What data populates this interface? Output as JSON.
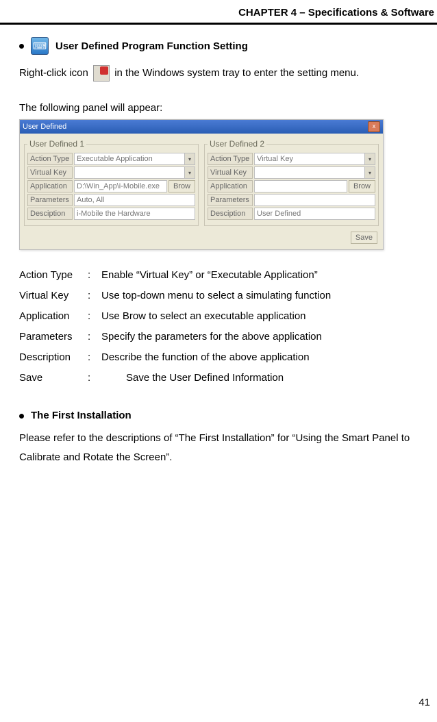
{
  "header": {
    "chapter": "CHAPTER 4 – Specifications & Software"
  },
  "s1": {
    "title": "User Defined Program Function Setting",
    "p1a": "Right-click icon ",
    "p1b": " in the Windows system tray to enter the setting menu.",
    "caption": "The following panel will appear:"
  },
  "panel": {
    "title": "User Defined",
    "close_x": "x",
    "g1": {
      "legend": "User Defined 1",
      "action_type_lbl": "Action Type",
      "action_type_val": "Executable Application",
      "virtual_key_lbl": "Virtual Key",
      "virtual_key_val": "",
      "application_lbl": "Application",
      "application_val": "D:\\Win_App\\i-Mobile.exe",
      "brow_btn": "Brow",
      "parameters_lbl": "Parameters",
      "parameters_val": "Auto, All",
      "desc_lbl": "Desciption",
      "desc_val": "i-Mobile the Hardware"
    },
    "g2": {
      "legend": "User Defined 2",
      "action_type_lbl": "Action Type",
      "action_type_val": "Virtual Key",
      "virtual_key_lbl": "Virtual Key",
      "virtual_key_val": "",
      "application_lbl": "Application",
      "application_val": "",
      "brow_btn": "Brow",
      "parameters_lbl": "Parameters",
      "parameters_val": "",
      "desc_lbl": "Desciption",
      "desc_val": "User Defined"
    },
    "save_btn": "Save"
  },
  "defs": {
    "r0": {
      "term": "Action Type",
      "desc": "Enable “Virtual Key” or “Executable Application”"
    },
    "r1": {
      "term": "Virtual Key",
      "desc": "Use top-down menu to select a simulating function"
    },
    "r2": {
      "term": "Application",
      "desc": "Use Brow to select an executable application"
    },
    "r3": {
      "term": "Parameters",
      "desc": "Specify the parameters for the above application"
    },
    "r4": {
      "term": "Description",
      "desc": "Describe the function of the above application"
    },
    "r5": {
      "term": "Save",
      "desc": "Save the User Defined Information"
    }
  },
  "s2": {
    "title": "The First Installation",
    "body": "Please refer to the descriptions of “The First Installation” for “Using the Smart Panel to Calibrate and Rotate the Screen”."
  },
  "page_number": "41"
}
